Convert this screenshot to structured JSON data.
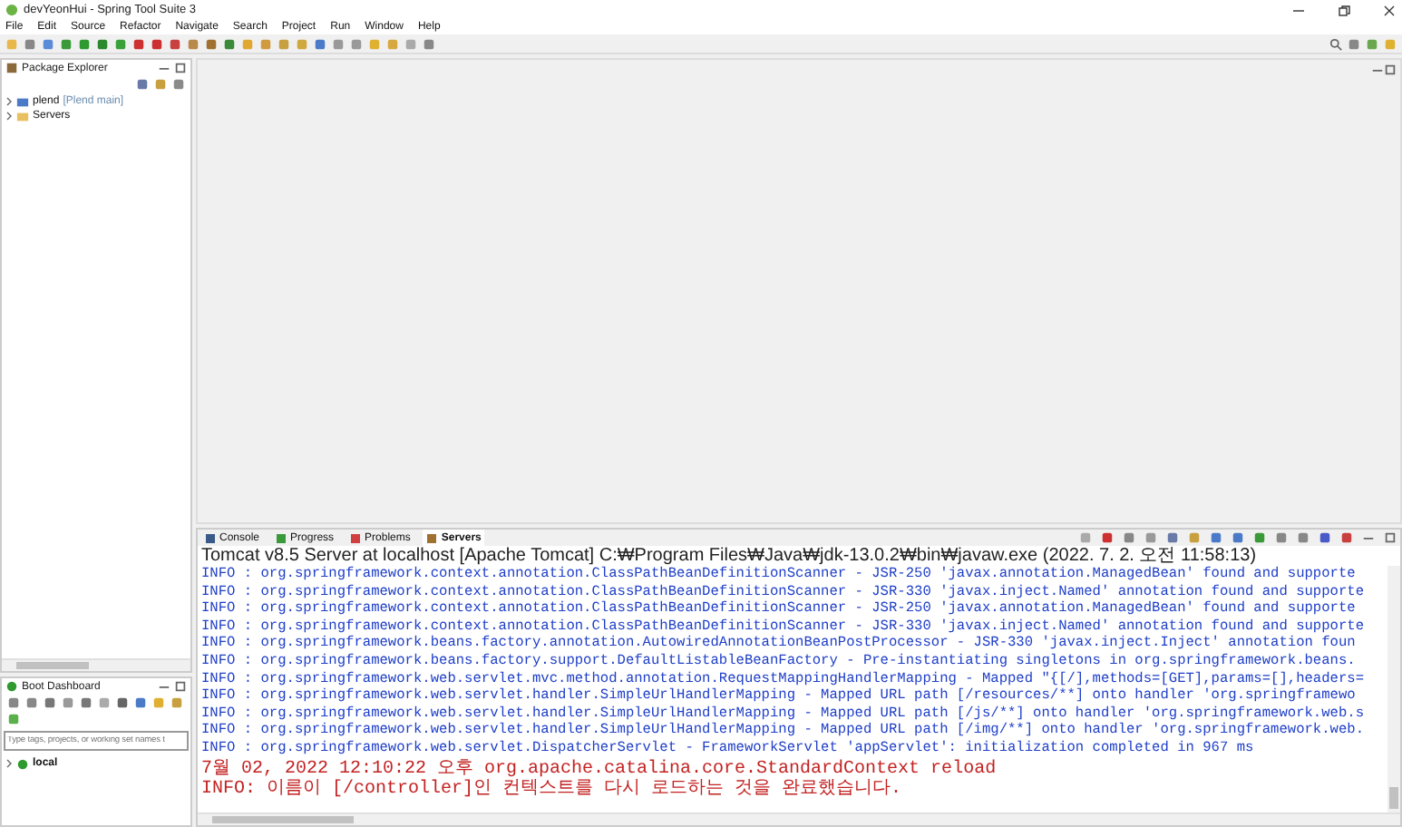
{
  "window": {
    "title": "devYeonHui - Spring Tool Suite 3"
  },
  "menu": [
    "File",
    "Edit",
    "Source",
    "Refactor",
    "Navigate",
    "Search",
    "Project",
    "Run",
    "Window",
    "Help"
  ],
  "package_explorer": {
    "title": "Package Explorer",
    "tree": [
      {
        "label": "plend",
        "detail": "[Plend main]",
        "kind": "project",
        "expanded": false
      },
      {
        "label": "Servers",
        "kind": "folder",
        "expanded": false
      }
    ]
  },
  "boot_dashboard": {
    "title": "Boot Dashboard",
    "filter": {
      "placeholder": "Type tags, projects, or working set names t"
    },
    "items": [
      {
        "label": "local",
        "expanded": false
      }
    ]
  },
  "console": {
    "tabs": [
      {
        "label": "Console",
        "selected": false,
        "kind": "console"
      },
      {
        "label": "Progress",
        "selected": false,
        "kind": "progress"
      },
      {
        "label": "Problems",
        "selected": false,
        "kind": "problems"
      },
      {
        "label": "Servers",
        "selected": true,
        "kind": "servers"
      }
    ],
    "description": "Tomcat v8.5 Server at localhost [Apache Tomcat] C:₩Program Files₩Java₩jdk-13.0.2₩bin₩javaw.exe  (2022. 7. 2. 오전 11:58:13)",
    "lines": [
      {
        "text": "INFO : org.springframework.context.annotation.ClassPathBeanDefinitionScanner - JSR-250 'javax.annotation.ManagedBean' found and supporte",
        "kind": "out"
      },
      {
        "text": "INFO : org.springframework.context.annotation.ClassPathBeanDefinitionScanner - JSR-330 'javax.inject.Named' annotation found and supporte",
        "kind": "out"
      },
      {
        "text": "INFO : org.springframework.context.annotation.ClassPathBeanDefinitionScanner - JSR-250 'javax.annotation.ManagedBean' found and supporte",
        "kind": "out"
      },
      {
        "text": "INFO : org.springframework.context.annotation.ClassPathBeanDefinitionScanner - JSR-330 'javax.inject.Named' annotation found and supporte",
        "kind": "out"
      },
      {
        "text": "INFO : org.springframework.beans.factory.annotation.AutowiredAnnotationBeanPostProcessor - JSR-330 'javax.inject.Inject' annotation foun",
        "kind": "out"
      },
      {
        "text": "INFO : org.springframework.beans.factory.support.DefaultListableBeanFactory - Pre-instantiating singletons in org.springframework.beans.",
        "kind": "out"
      },
      {
        "text": "INFO : org.springframework.web.servlet.mvc.method.annotation.RequestMappingHandlerMapping - Mapped \"{[/],methods=[GET],params=[],headers=",
        "kind": "out"
      },
      {
        "text": "INFO : org.springframework.web.servlet.handler.SimpleUrlHandlerMapping - Mapped URL path [/resources/**] onto handler 'org.springframewo",
        "kind": "out"
      },
      {
        "text": "INFO : org.springframework.web.servlet.handler.SimpleUrlHandlerMapping - Mapped URL path [/js/**] onto handler 'org.springframework.web.s",
        "kind": "out"
      },
      {
        "text": "INFO : org.springframework.web.servlet.handler.SimpleUrlHandlerMapping - Mapped URL path [/img/**] onto handler 'org.springframework.web.",
        "kind": "out"
      },
      {
        "text": "INFO : org.springframework.web.servlet.DispatcherServlet - FrameworkServlet 'appServlet': initialization completed in 967 ms",
        "kind": "out"
      },
      {
        "text": "7월 02, 2022 12:10:22 오후 org.apache.catalina.core.StandardContext reload",
        "kind": "err"
      },
      {
        "text": "INFO: 이름이 [/controller]인 컨텍스트를 다시 로드하는 것을 완료했습니다.",
        "kind": "err"
      }
    ]
  }
}
